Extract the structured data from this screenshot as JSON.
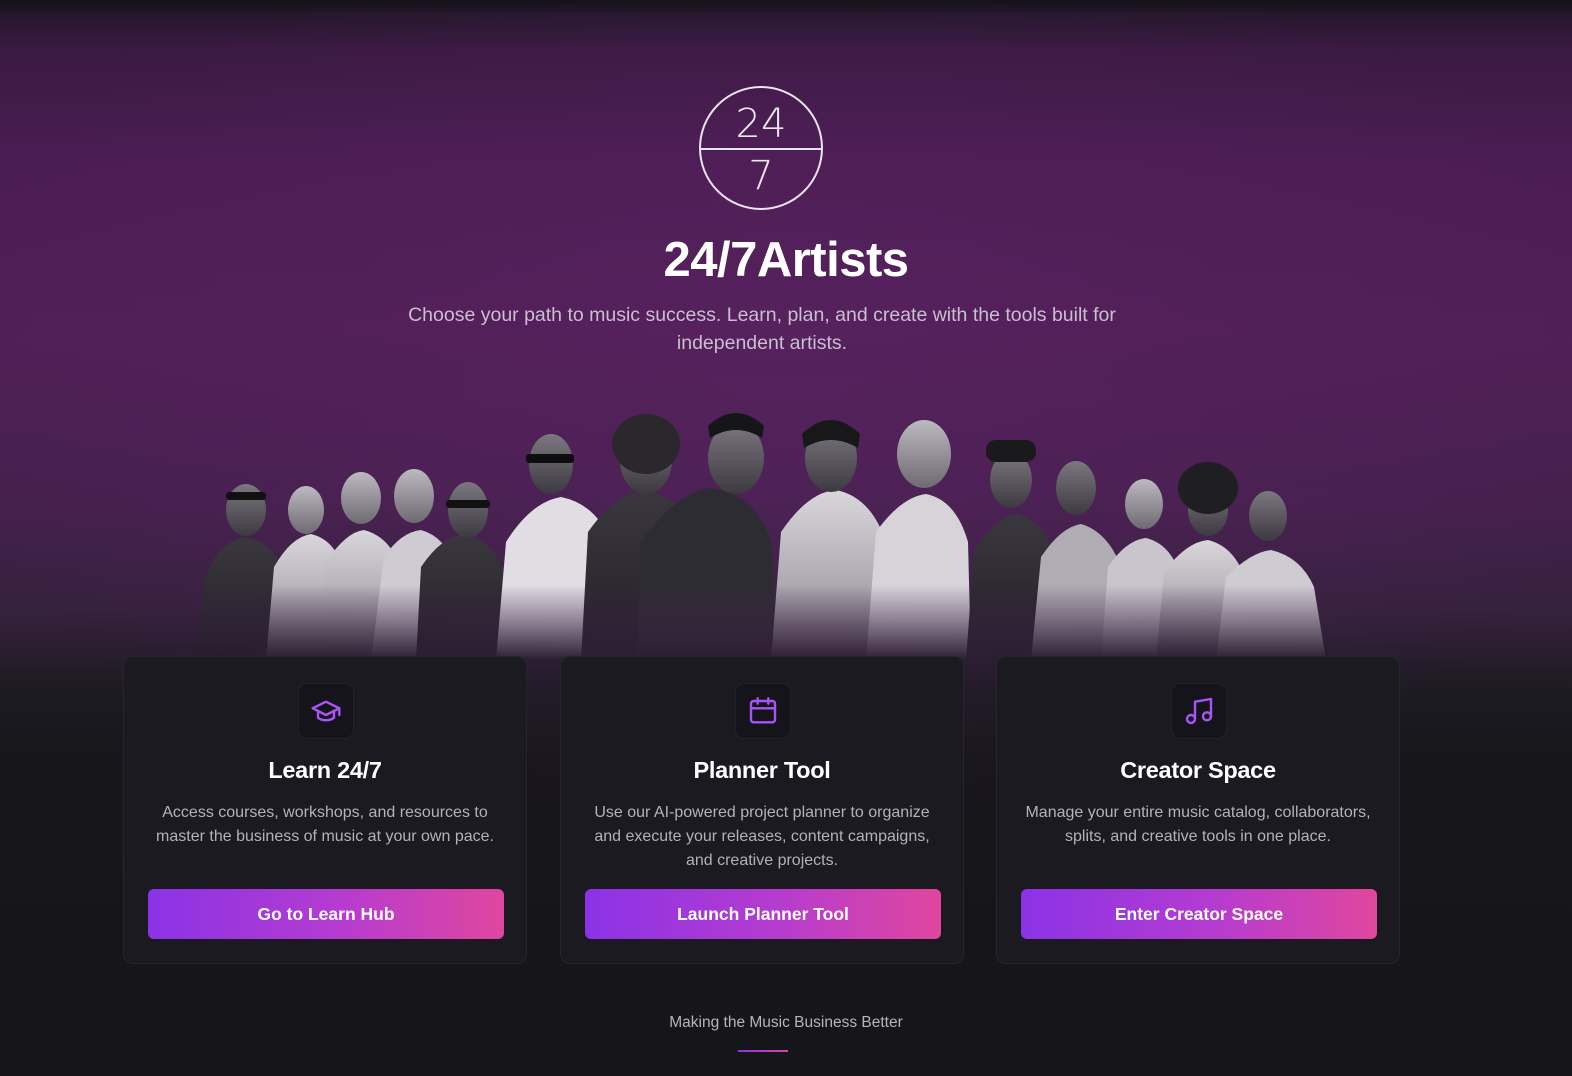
{
  "brand": {
    "logo_top": "24",
    "logo_bottom": "7",
    "name": "24/7Artists",
    "tagline": "Choose your path to music success. Learn, plan, and create with the tools built for independent artists."
  },
  "icons": {
    "card_1": "graduation-cap-icon",
    "card_2": "calendar-icon",
    "card_3": "music-note-icon"
  },
  "colors": {
    "accent_purple": "#8a33e6",
    "accent_pink": "#e0469e",
    "hero_bg": "#4f1f55",
    "card_bg": "#1b1a20"
  },
  "cards": [
    {
      "title": "Learn 24/7",
      "description": "Access courses, workshops, and resources to master the business of music at your own pace.",
      "button": "Go to Learn Hub"
    },
    {
      "title": "Planner Tool",
      "description": "Use our AI-powered project planner to organize and execute your releases, content campaigns, and creative projects.",
      "button": "Launch Planner Tool"
    },
    {
      "title": "Creator Space",
      "description": "Manage your entire music catalog, collaborators, splits, and creative tools in one place.",
      "button": "Enter Creator Space"
    }
  ],
  "footer": {
    "text": "Making the Music Business Better"
  }
}
